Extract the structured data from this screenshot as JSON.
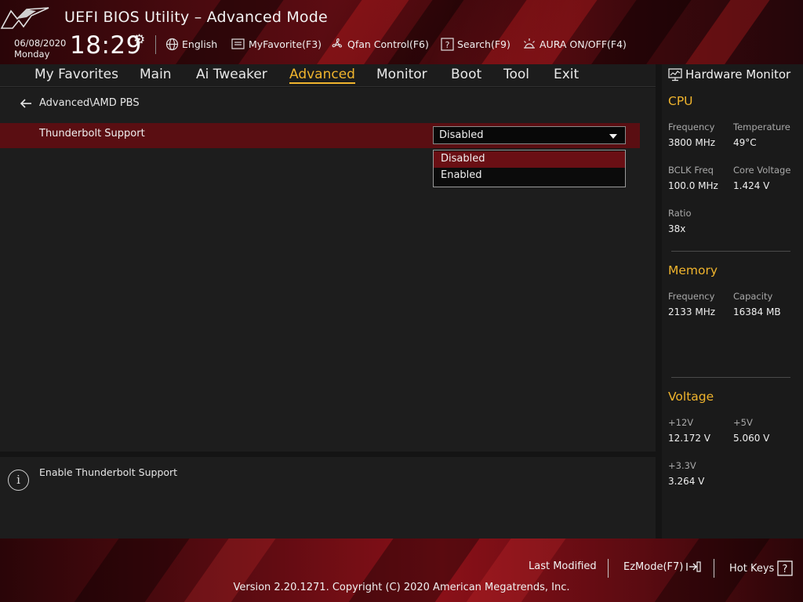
{
  "header": {
    "title": "UEFI BIOS Utility – Advanced Mode",
    "date": "06/08/2020",
    "day": "Monday",
    "time": "18:29",
    "tools": {
      "language": "English",
      "myfavorite": "MyFavorite(F3)",
      "qfan": "Qfan Control(F6)",
      "search": "Search(F9)",
      "aura": "AURA ON/OFF(F4)"
    }
  },
  "nav": {
    "tabs": [
      "My Favorites",
      "Main",
      "Ai Tweaker",
      "Advanced",
      "Monitor",
      "Boot",
      "Tool",
      "Exit"
    ],
    "active": "Advanced"
  },
  "main": {
    "breadcrumb": "Advanced\\AMD PBS",
    "setting": {
      "label": "Thunderbolt Support",
      "value": "Disabled",
      "options": [
        "Disabled",
        "Enabled"
      ]
    }
  },
  "help": {
    "text": "Enable Thunderbolt Support"
  },
  "hardware_monitor": {
    "title": "Hardware Monitor",
    "cpu": {
      "title": "CPU",
      "frequency_label": "Frequency",
      "frequency": "3800 MHz",
      "temperature_label": "Temperature",
      "temperature": "49°C",
      "bclk_label": "BCLK Freq",
      "bclk": "100.0 MHz",
      "core_voltage_label": "Core Voltage",
      "core_voltage": "1.424 V",
      "ratio_label": "Ratio",
      "ratio": "38x"
    },
    "memory": {
      "title": "Memory",
      "frequency_label": "Frequency",
      "frequency": "2133 MHz",
      "capacity_label": "Capacity",
      "capacity": "16384 MB"
    },
    "voltage": {
      "title": "Voltage",
      "v12_label": "+12V",
      "v12": "12.172 V",
      "v5_label": "+5V",
      "v5": "5.060 V",
      "v33_label": "+3.3V",
      "v33": "3.264 V"
    }
  },
  "footer": {
    "last_modified": "Last Modified",
    "ezmode": "EzMode(F7)",
    "hotkeys": "Hot Keys",
    "copyright": "Version 2.20.1271. Copyright (C) 2020 American Megatrends, Inc."
  },
  "colors": {
    "accent": "#f0b42d",
    "selected_row": "#5a0e12",
    "brand_red": "#8a1018"
  }
}
